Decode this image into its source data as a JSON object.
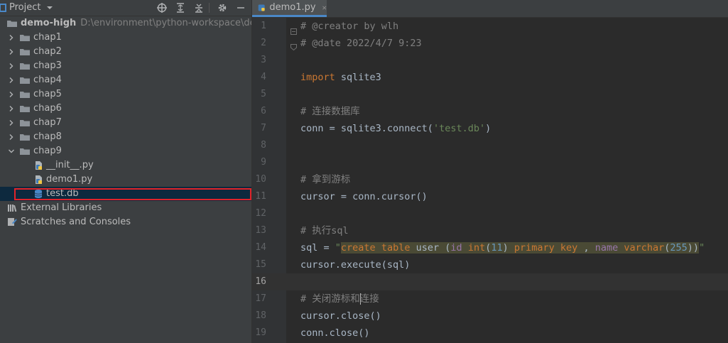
{
  "project_panel": {
    "title": "Project",
    "toolbar_icons": [
      "locate-icon",
      "expand-all-icon",
      "collapse-all-icon",
      "gear-icon",
      "hide-icon"
    ],
    "tree": [
      {
        "label": "demo-high",
        "path": "D:\\environment\\python-workspace\\demo-h",
        "icon": "folder-icon",
        "expanded": true
      },
      {
        "label": "chap1",
        "icon": "folder-icon",
        "expanded": false
      },
      {
        "label": "chap2",
        "icon": "folder-icon",
        "expanded": false
      },
      {
        "label": "chap3",
        "icon": "folder-icon",
        "expanded": false
      },
      {
        "label": "chap4",
        "icon": "folder-icon",
        "expanded": false
      },
      {
        "label": "chap5",
        "icon": "folder-icon",
        "expanded": false
      },
      {
        "label": "chap6",
        "icon": "folder-icon",
        "expanded": false
      },
      {
        "label": "chap7",
        "icon": "folder-icon",
        "expanded": false
      },
      {
        "label": "chap8",
        "icon": "folder-icon",
        "expanded": false
      },
      {
        "label": "chap9",
        "icon": "folder-icon",
        "expanded": true
      },
      {
        "label": "__init__.py",
        "icon": "python-file-icon"
      },
      {
        "label": "demo1.py",
        "icon": "python-file-icon"
      },
      {
        "label": "test.db",
        "icon": "database-file-icon",
        "selected": true
      },
      {
        "label": "External Libraries",
        "icon": "library-icon"
      },
      {
        "label": "Scratches and Consoles",
        "icon": "scratches-icon"
      }
    ]
  },
  "editor": {
    "tab_label": "demo1.py",
    "tab_icon": "python-file-icon",
    "current_line": 16,
    "lines": [
      {
        "n": "1",
        "text": "# @creator by wlh"
      },
      {
        "n": "2",
        "text": "# @date 2022/4/7 9:23"
      },
      {
        "n": "3",
        "text": ""
      },
      {
        "n": "4",
        "text": "import sqlite3"
      },
      {
        "n": "5",
        "text": ""
      },
      {
        "n": "6",
        "text": "# 连接数据库"
      },
      {
        "n": "7",
        "text": "conn = sqlite3.connect('test.db')"
      },
      {
        "n": "8",
        "text": ""
      },
      {
        "n": "9",
        "text": ""
      },
      {
        "n": "10",
        "text": "# 拿到游标"
      },
      {
        "n": "11",
        "text": "cursor = conn.cursor()"
      },
      {
        "n": "12",
        "text": ""
      },
      {
        "n": "13",
        "text": "# 执行sql"
      },
      {
        "n": "14",
        "text": "sql = \"create table user (id int(11) primary key , name varchar(255))\""
      },
      {
        "n": "15",
        "text": "cursor.execute(sql)"
      },
      {
        "n": "16",
        "text": ""
      },
      {
        "n": "17",
        "text": "# 关闭游标和连接"
      },
      {
        "n": "18",
        "text": "cursor.close()"
      },
      {
        "n": "19",
        "text": "conn.close()"
      }
    ]
  },
  "colors": {
    "comment": "#808080",
    "keyword": "#cc7832",
    "string": "#6a8759",
    "number": "#6897bb",
    "identifier": "#9876aa",
    "selection_outline": "#e0242a"
  }
}
